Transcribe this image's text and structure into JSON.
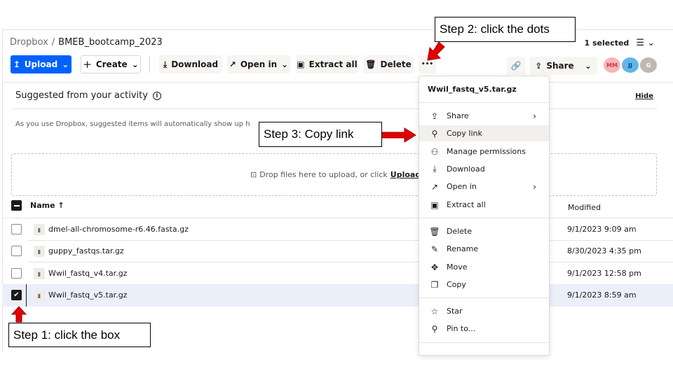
{
  "breadcrumb": {
    "root": "Dropbox",
    "separator": "/",
    "folder": "BMEB_bootcamp_2023"
  },
  "selection": {
    "label": "1 selected"
  },
  "toolbar": {
    "upload": "Upload",
    "create": "Create",
    "download": "Download",
    "open_in": "Open in",
    "extract_all": "Extract all",
    "delete": "Delete",
    "more": "•••",
    "share": "Share"
  },
  "avatars": [
    {
      "initials": "MM",
      "color": "#fbb3b3"
    },
    {
      "initials": "JJ",
      "color": "#5fb7e8"
    },
    {
      "initials": "G",
      "color": "#bdb8b3"
    }
  ],
  "suggested": {
    "title": "Suggested from your activity",
    "hide": "Hide",
    "description": "As you use Dropbox, suggested items will automatically show up h"
  },
  "dropzone": {
    "text": "Drop files here to upload, or click",
    "link": "Upload"
  },
  "table": {
    "col_name": "Name",
    "sort_arrow": "↑",
    "col_modified": "Modified",
    "rows": [
      {
        "name": "dmel-all-chromosome-r6.46.fasta.gz",
        "modified": "9/1/2023 9:09 am",
        "selected": false
      },
      {
        "name": "guppy_fastqs.tar.gz",
        "modified": "8/30/2023 4:35 pm",
        "selected": false
      },
      {
        "name": "Wwil_fastq_v4.tar.gz",
        "modified": "9/1/2023 12:58 pm",
        "selected": false
      },
      {
        "name": "Wwil_fastq_v5.tar.gz",
        "modified": "9/1/2023 8:59 am",
        "selected": true
      }
    ]
  },
  "menu": {
    "title": "Wwil_fastq_v5.tar.gz",
    "items": [
      {
        "label": "Share",
        "icon": "share-icon",
        "submenu": true
      },
      {
        "label": "Copy link",
        "icon": "link-icon",
        "submenu": false
      },
      {
        "label": "Manage permissions",
        "icon": "people-icon",
        "submenu": false
      },
      {
        "label": "Download",
        "icon": "download-icon",
        "submenu": false
      },
      {
        "label": "Open in",
        "icon": "open-in-icon",
        "submenu": true
      },
      {
        "label": "Extract all",
        "icon": "extract-icon",
        "submenu": false
      },
      {
        "label": "Delete",
        "icon": "trash-icon",
        "submenu": false
      },
      {
        "label": "Rename",
        "icon": "rename-icon",
        "submenu": false
      },
      {
        "label": "Move",
        "icon": "move-icon",
        "submenu": false
      },
      {
        "label": "Copy",
        "icon": "copy-icon",
        "submenu": false
      },
      {
        "label": "Star",
        "icon": "star-icon",
        "submenu": false
      },
      {
        "label": "Pin to...",
        "icon": "pin-icon",
        "submenu": false
      }
    ]
  },
  "annotations": {
    "step1": "Step 1: click the box",
    "step2": "Step 2: click the dots",
    "step3": "Step 3: Copy link"
  },
  "colors": {
    "accent": "#0061fe",
    "arrow": "#e00000",
    "selected_row": "#ebeffa"
  }
}
